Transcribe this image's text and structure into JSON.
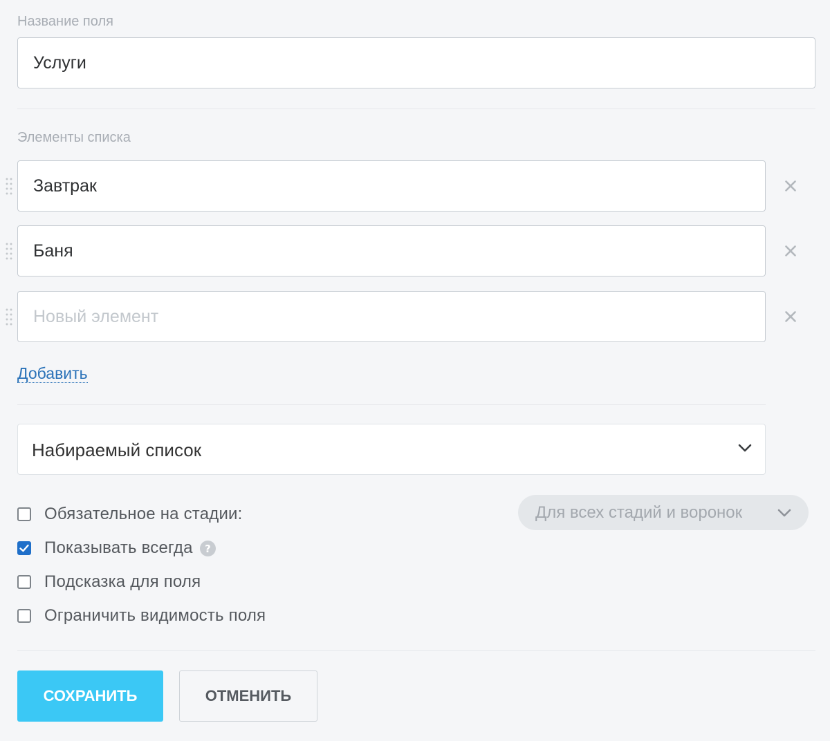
{
  "field_name": {
    "label": "Название поля",
    "value": "Услуги"
  },
  "list_elements": {
    "label": "Элементы списка",
    "items": [
      {
        "value": "Завтрак",
        "placeholder": ""
      },
      {
        "value": "Баня",
        "placeholder": ""
      },
      {
        "value": "",
        "placeholder": "Новый элемент"
      }
    ],
    "add_label": "Добавить"
  },
  "list_type": {
    "selected": "Набираемый список"
  },
  "options": {
    "required": {
      "label": "Обязательное на стадии:",
      "checked": false
    },
    "show_always": {
      "label": "Показывать всегда",
      "checked": true
    },
    "hint": {
      "label": "Подсказка для поля",
      "checked": false
    },
    "limit_visibility": {
      "label": "Ограничить видимость поля",
      "checked": false
    }
  },
  "stage_selector": {
    "value": "Для всех стадий и воронок"
  },
  "buttons": {
    "save": "СОХРАНИТЬ",
    "cancel": "ОТМЕНИТЬ"
  },
  "colors": {
    "accent": "#3bc8f5",
    "link": "#2a72b8",
    "checkbox_checked": "#1f6fc9",
    "background": "#f5f6f8"
  },
  "icons": {
    "drag": "drag-handle-icon",
    "remove": "close-icon",
    "dropdown": "chevron-down-icon",
    "help": "question-icon",
    "check": "check-icon"
  }
}
